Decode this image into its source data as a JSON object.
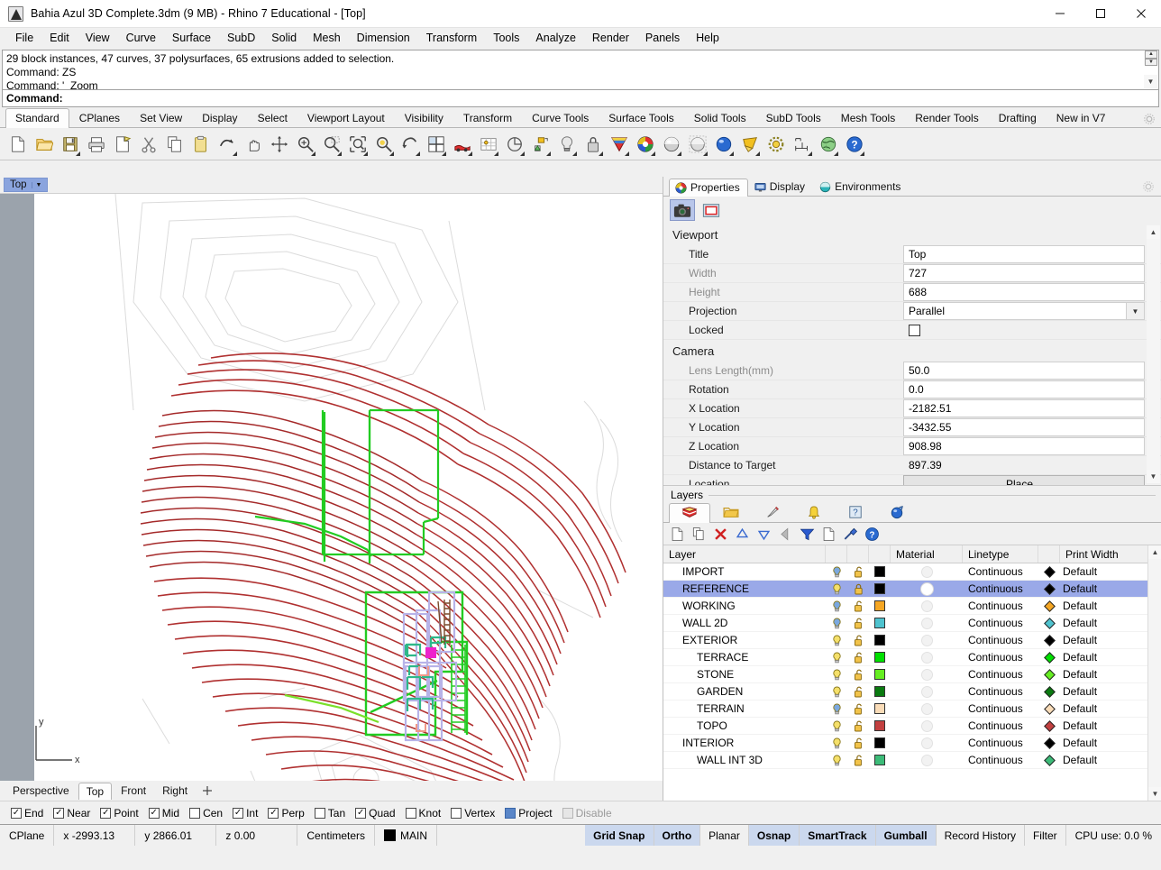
{
  "window": {
    "title": "Bahia Azul 3D Complete.3dm (9 MB) - Rhino 7 Educational - [Top]",
    "minimize": "—",
    "maximize": "☐",
    "close": "✕"
  },
  "menubar": {
    "items": [
      "File",
      "Edit",
      "View",
      "Curve",
      "Surface",
      "SubD",
      "Solid",
      "Mesh",
      "Dimension",
      "Transform",
      "Tools",
      "Analyze",
      "Render",
      "Panels",
      "Help"
    ]
  },
  "command": {
    "history": [
      "29 block instances, 47 curves, 37 polysurfaces, 65 extrusions added to selection.",
      "Command: ZS",
      "Command: '_Zoom"
    ],
    "prompt": "Command:"
  },
  "toolbar_tabs": {
    "items": [
      "Standard",
      "CPlanes",
      "Set View",
      "Display",
      "Select",
      "Viewport Layout",
      "Visibility",
      "Transform",
      "Curve Tools",
      "Surface Tools",
      "Solid Tools",
      "SubD Tools",
      "Mesh Tools",
      "Render Tools",
      "Drafting",
      "New in V7"
    ],
    "active": "Standard",
    "gear_icon": "gear-icon"
  },
  "toolbar_icons": [
    {
      "name": "new-file-icon",
      "flyout": false
    },
    {
      "name": "open-file-icon",
      "flyout": false
    },
    {
      "name": "save-file-icon",
      "flyout": true
    },
    {
      "name": "print-icon",
      "flyout": false
    },
    {
      "name": "export-icon",
      "flyout": false
    },
    {
      "name": "cut-icon",
      "flyout": false
    },
    {
      "name": "copy-icon",
      "flyout": false
    },
    {
      "name": "paste-icon",
      "flyout": false
    },
    {
      "name": "undo-icon",
      "flyout": true
    },
    {
      "name": "pan-icon",
      "flyout": false
    },
    {
      "name": "move-icon",
      "flyout": false
    },
    {
      "name": "zoom-in-icon",
      "flyout": true
    },
    {
      "name": "zoom-dynamic-icon",
      "flyout": true
    },
    {
      "name": "zoom-window-icon",
      "flyout": true
    },
    {
      "name": "zoom-selected-icon",
      "flyout": true
    },
    {
      "name": "rotate-view-icon",
      "flyout": true
    },
    {
      "name": "four-viewport-icon",
      "flyout": true
    },
    {
      "name": "named-view-icon",
      "flyout": true
    },
    {
      "name": "grid-snap-icon",
      "flyout": true
    },
    {
      "name": "planar-icon",
      "flyout": true
    },
    {
      "name": "cplane-icon",
      "flyout": true
    },
    {
      "name": "light-icon",
      "flyout": true
    },
    {
      "name": "lock-icon",
      "flyout": true
    },
    {
      "name": "layer-color-icon",
      "flyout": true
    },
    {
      "name": "color-wheel-icon",
      "flyout": true
    },
    {
      "name": "shaded-view-icon",
      "flyout": true
    },
    {
      "name": "ghosted-view-icon",
      "flyout": true
    },
    {
      "name": "rendered-view-icon",
      "flyout": true
    },
    {
      "name": "clipping-plane-icon",
      "flyout": true
    },
    {
      "name": "render-settings-icon",
      "flyout": false
    },
    {
      "name": "dimension-icon",
      "flyout": true
    },
    {
      "name": "earth-icon",
      "flyout": true
    },
    {
      "name": "help-icon",
      "flyout": true
    }
  ],
  "viewport": {
    "tab_label": "Top",
    "axis_x": "x",
    "axis_y": "y",
    "view_tabs": [
      "Perspective",
      "Top",
      "Front",
      "Right"
    ],
    "active_view": "Top",
    "add_view_icon": "add-viewport-icon",
    "colors": {
      "contour": "#b03030",
      "selected": "#b7b3e8",
      "green": "#22cc22",
      "teal": "#2eb88a",
      "magenta": "#ee22cc",
      "salmon": "#f09888",
      "background": "#ffffff",
      "left_strip": "#9ba3ac"
    }
  },
  "properties_panel": {
    "tabs": [
      {
        "label": "Properties",
        "icon": "color-wheel-icon",
        "active": true
      },
      {
        "label": "Display",
        "icon": "monitor-icon",
        "active": false
      },
      {
        "label": "Environments",
        "icon": "environment-sphere-icon",
        "active": false
      }
    ],
    "gear_icon": "gear-icon",
    "toolbuttons": [
      {
        "name": "camera-properties-icon",
        "selected": true
      },
      {
        "name": "viewport-properties-icon",
        "selected": false
      }
    ],
    "sections": [
      {
        "title": "Viewport",
        "rows": [
          {
            "label": "Title",
            "value": "Top",
            "type": "text",
            "dim": false
          },
          {
            "label": "Width",
            "value": "727",
            "type": "text",
            "dim": true
          },
          {
            "label": "Height",
            "value": "688",
            "type": "text",
            "dim": true
          },
          {
            "label": "Projection",
            "value": "Parallel",
            "type": "combo",
            "dim": false
          },
          {
            "label": "Locked",
            "value": "",
            "type": "checkbox",
            "dim": false
          }
        ]
      },
      {
        "title": "Camera",
        "rows": [
          {
            "label": "Lens Length(mm)",
            "value": "50.0",
            "type": "text",
            "dim": true
          },
          {
            "label": "Rotation",
            "value": "0.0",
            "type": "text",
            "dim": false
          },
          {
            "label": "X Location",
            "value": "-2182.51",
            "type": "text",
            "dim": false
          },
          {
            "label": "Y Location",
            "value": "-3432.55",
            "type": "text",
            "dim": false
          },
          {
            "label": "Z Location",
            "value": "908.98",
            "type": "text",
            "dim": false
          },
          {
            "label": "Distance to Target",
            "value": "897.39",
            "type": "plain",
            "dim": false
          },
          {
            "label": "Location",
            "value": "Place...",
            "type": "button",
            "dim": false
          }
        ]
      }
    ]
  },
  "layers_panel": {
    "header": "Layers",
    "tabs": [
      {
        "name": "layers-tab-icon",
        "active": true
      },
      {
        "name": "folder-tab-icon",
        "active": false
      },
      {
        "name": "linetype-tab-icon",
        "active": false
      },
      {
        "name": "notification-tab-icon",
        "active": false
      },
      {
        "name": "named-position-tab-icon",
        "active": false
      },
      {
        "name": "environment-tab-icon",
        "active": false
      }
    ],
    "tools": [
      {
        "name": "new-layer-icon"
      },
      {
        "name": "duplicate-layer-icon"
      },
      {
        "name": "delete-layer-icon"
      },
      {
        "name": "move-layer-up-icon"
      },
      {
        "name": "move-layer-down-icon"
      },
      {
        "name": "previous-layer-icon"
      },
      {
        "name": "filter-layers-icon"
      },
      {
        "name": "layer-properties-icon"
      },
      {
        "name": "layer-tools-icon"
      },
      {
        "name": "layer-help-icon"
      }
    ],
    "columns": [
      "Layer",
      "",
      "",
      "",
      "Material",
      "Linetype",
      "",
      "Print Width"
    ],
    "rows": [
      {
        "name": "IMPORT",
        "indent": 0,
        "expander": "",
        "on": true,
        "on_style": "blue",
        "locked": false,
        "color": "#000000",
        "material": "dot",
        "linetype": "Continuous",
        "print_color": "#000000",
        "print_width": "Default",
        "selected": false
      },
      {
        "name": "REFERENCE",
        "indent": 0,
        "expander": "",
        "on": true,
        "on_style": "yellow",
        "locked": true,
        "color": "#000000",
        "material": "white",
        "linetype": "Continuous",
        "print_color": "#000000",
        "print_width": "Default",
        "selected": true
      },
      {
        "name": "WORKING",
        "indent": 0,
        "expander": "",
        "on": true,
        "on_style": "blue",
        "locked": false,
        "color": "#f5a623",
        "material": "dot",
        "linetype": "Continuous",
        "print_color": "#f5a623",
        "print_width": "Default",
        "selected": false
      },
      {
        "name": "WALL 2D",
        "indent": 0,
        "expander": "",
        "on": true,
        "on_style": "blue",
        "locked": false,
        "color": "#4fc3cf",
        "material": "dot",
        "linetype": "Continuous",
        "print_color": "#4fc3cf",
        "print_width": "Default",
        "selected": false
      },
      {
        "name": "EXTERIOR",
        "indent": 0,
        "expander": "ⱟ",
        "on": true,
        "on_style": "yellow",
        "locked": false,
        "color": "#000000",
        "material": "dot",
        "linetype": "Continuous",
        "print_color": "#000000",
        "print_width": "Default",
        "selected": false
      },
      {
        "name": "TERRACE",
        "indent": 1,
        "expander": "",
        "on": true,
        "on_style": "yellow",
        "locked": false,
        "color": "#00e000",
        "material": "dot",
        "linetype": "Continuous",
        "print_color": "#00e000",
        "print_width": "Default",
        "selected": false
      },
      {
        "name": "STONE",
        "indent": 1,
        "expander": "",
        "on": true,
        "on_style": "yellow",
        "locked": false,
        "color": "#66ee22",
        "material": "dot",
        "linetype": "Continuous",
        "print_color": "#66ee22",
        "print_width": "Default",
        "selected": false
      },
      {
        "name": "GARDEN",
        "indent": 1,
        "expander": "",
        "on": true,
        "on_style": "yellow",
        "locked": false,
        "color": "#0a7a10",
        "material": "dot",
        "linetype": "Continuous",
        "print_color": "#0a7a10",
        "print_width": "Default",
        "selected": false
      },
      {
        "name": "TERRAIN",
        "indent": 1,
        "expander": "",
        "on": true,
        "on_style": "blue",
        "locked": false,
        "color": "#fadcb8",
        "material": "dot",
        "linetype": "Continuous",
        "print_color": "#fadcb8",
        "print_width": "Default",
        "selected": false
      },
      {
        "name": "TOPO",
        "indent": 1,
        "expander": "",
        "on": true,
        "on_style": "yellow",
        "locked": false,
        "color": "#c24040",
        "material": "dot",
        "linetype": "Continuous",
        "print_color": "#c24040",
        "print_width": "Default",
        "selected": false
      },
      {
        "name": "INTERIOR",
        "indent": 0,
        "expander": "ⱟ",
        "on": true,
        "on_style": "yellow",
        "locked": false,
        "color": "#000000",
        "material": "dot",
        "linetype": "Continuous",
        "print_color": "#000000",
        "print_width": "Default",
        "selected": false
      },
      {
        "name": "WALL INT 3D",
        "indent": 1,
        "expander": "ⱟ",
        "on": true,
        "on_style": "yellow",
        "locked": false,
        "color": "#3cbb78",
        "material": "dot",
        "linetype": "Continuous",
        "print_color": "#3cbb78",
        "print_width": "Default",
        "selected": false
      }
    ]
  },
  "osnap_bar": {
    "items": [
      {
        "label": "End",
        "checked": true,
        "disabled": false
      },
      {
        "label": "Near",
        "checked": true,
        "disabled": false
      },
      {
        "label": "Point",
        "checked": true,
        "disabled": false
      },
      {
        "label": "Mid",
        "checked": true,
        "disabled": false
      },
      {
        "label": "Cen",
        "checked": false,
        "disabled": false
      },
      {
        "label": "Int",
        "checked": true,
        "disabled": false
      },
      {
        "label": "Perp",
        "checked": true,
        "disabled": false
      },
      {
        "label": "Tan",
        "checked": false,
        "disabled": false
      },
      {
        "label": "Quad",
        "checked": true,
        "disabled": false
      },
      {
        "label": "Knot",
        "checked": false,
        "disabled": false
      },
      {
        "label": "Vertex",
        "checked": false,
        "disabled": false
      },
      {
        "label": "Project",
        "checked": false,
        "disabled": false,
        "filled": true
      },
      {
        "label": "Disable",
        "checked": false,
        "disabled": true
      }
    ]
  },
  "statusbar": {
    "cplane": "CPlane",
    "x": "x -2993.13",
    "y": "y 2866.01",
    "z": "z 0.00",
    "units": "Centimeters",
    "layer": "MAIN",
    "layer_color": "#000000",
    "toggles": [
      {
        "label": "Grid Snap",
        "on": true
      },
      {
        "label": "Ortho",
        "on": true
      },
      {
        "label": "Planar",
        "on": false
      },
      {
        "label": "Osnap",
        "on": true
      },
      {
        "label": "SmartTrack",
        "on": true
      },
      {
        "label": "Gumball",
        "on": true
      },
      {
        "label": "Record History",
        "on": false
      },
      {
        "label": "Filter",
        "on": false
      }
    ],
    "cpu": "CPU use: 0.0 %"
  }
}
